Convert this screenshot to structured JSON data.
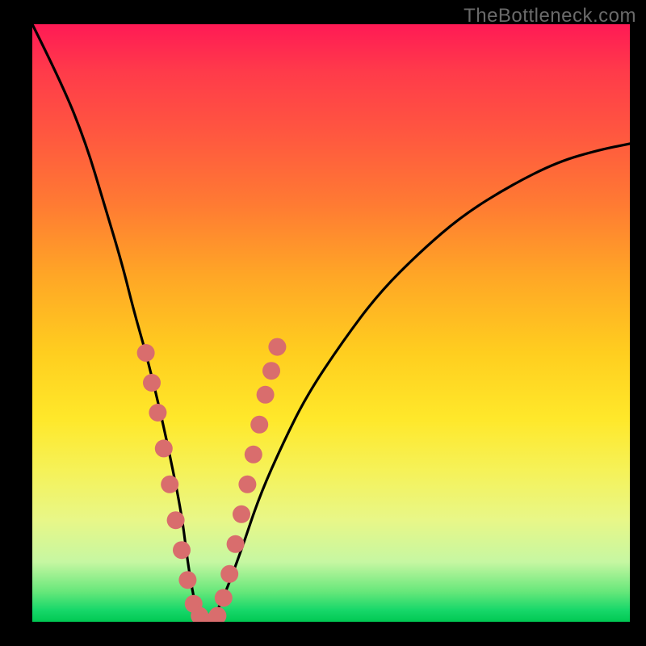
{
  "watermark": "TheBottleneck.com",
  "colors": {
    "background": "#000000",
    "gradient_top": "#ff1a55",
    "gradient_bottom": "#00c853",
    "curve": "#000000",
    "dot": "#d96d6d"
  },
  "chart_data": {
    "type": "line",
    "title": "",
    "xlabel": "",
    "ylabel": "",
    "xlim": [
      0,
      100
    ],
    "ylim": [
      0,
      100
    ],
    "grid": false,
    "legend": false,
    "series": [
      {
        "name": "bottleneck-curve",
        "x": [
          0,
          5,
          9,
          12,
          15,
          17,
          19,
          21,
          23,
          25,
          26,
          27,
          28,
          30,
          32,
          35,
          38,
          42,
          46,
          52,
          58,
          65,
          72,
          80,
          88,
          95,
          100
        ],
        "values": [
          100,
          90,
          80,
          70,
          60,
          52,
          45,
          37,
          28,
          18,
          10,
          4,
          0,
          0,
          4,
          12,
          21,
          30,
          38,
          47,
          55,
          62,
          68,
          73,
          77,
          79,
          80
        ]
      }
    ],
    "markers": [
      {
        "x": 19,
        "y": 45
      },
      {
        "x": 20,
        "y": 40
      },
      {
        "x": 21,
        "y": 35
      },
      {
        "x": 22,
        "y": 29
      },
      {
        "x": 23,
        "y": 23
      },
      {
        "x": 24,
        "y": 17
      },
      {
        "x": 25,
        "y": 12
      },
      {
        "x": 26,
        "y": 7
      },
      {
        "x": 27,
        "y": 3
      },
      {
        "x": 28,
        "y": 1
      },
      {
        "x": 29,
        "y": 0
      },
      {
        "x": 30,
        "y": 0
      },
      {
        "x": 31,
        "y": 1
      },
      {
        "x": 32,
        "y": 4
      },
      {
        "x": 33,
        "y": 8
      },
      {
        "x": 34,
        "y": 13
      },
      {
        "x": 35,
        "y": 18
      },
      {
        "x": 36,
        "y": 23
      },
      {
        "x": 37,
        "y": 28
      },
      {
        "x": 38,
        "y": 33
      },
      {
        "x": 39,
        "y": 38
      },
      {
        "x": 40,
        "y": 42
      },
      {
        "x": 41,
        "y": 46
      }
    ]
  }
}
